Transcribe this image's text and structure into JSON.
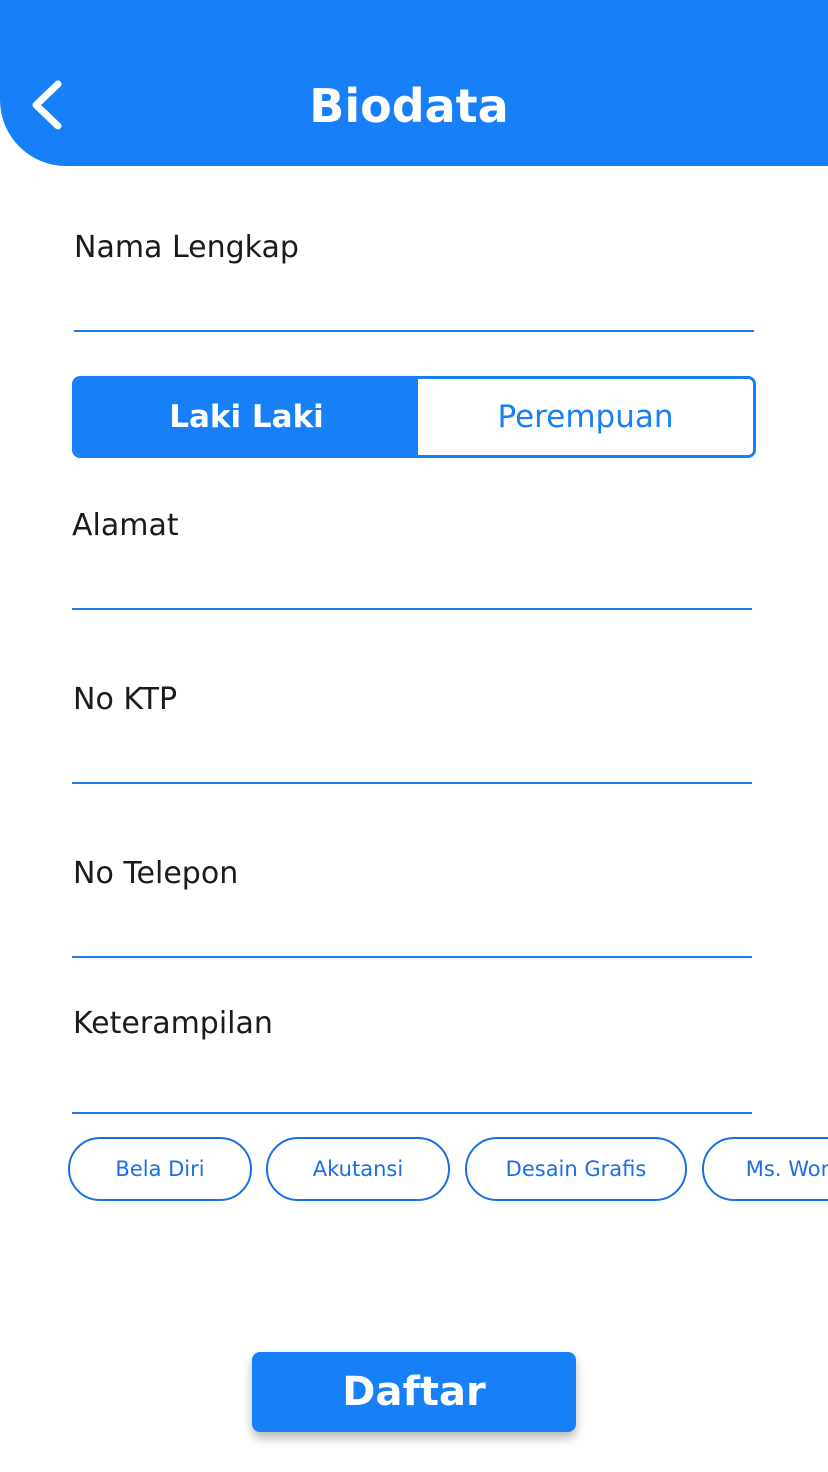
{
  "header": {
    "title": "Biodata",
    "back_icon": "chevron-left-icon",
    "color": "#1780f8"
  },
  "form": {
    "nama_lengkap": {
      "label": "Nama Lengkap",
      "value": ""
    },
    "gender": {
      "options": [
        "Laki Laki",
        "Perempuan"
      ],
      "selected": "Laki Laki"
    },
    "alamat": {
      "label": "Alamat",
      "value": ""
    },
    "no_ktp": {
      "label": "No KTP",
      "value": ""
    },
    "no_telepon": {
      "label": "No Telepon",
      "value": ""
    },
    "keterampilan": {
      "label": "Keterampilan",
      "value": ""
    }
  },
  "skills": [
    "Bela Diri",
    "Akutansi",
    "Desain Grafis",
    "Ms. Word"
  ],
  "submit_label": "Daftar"
}
